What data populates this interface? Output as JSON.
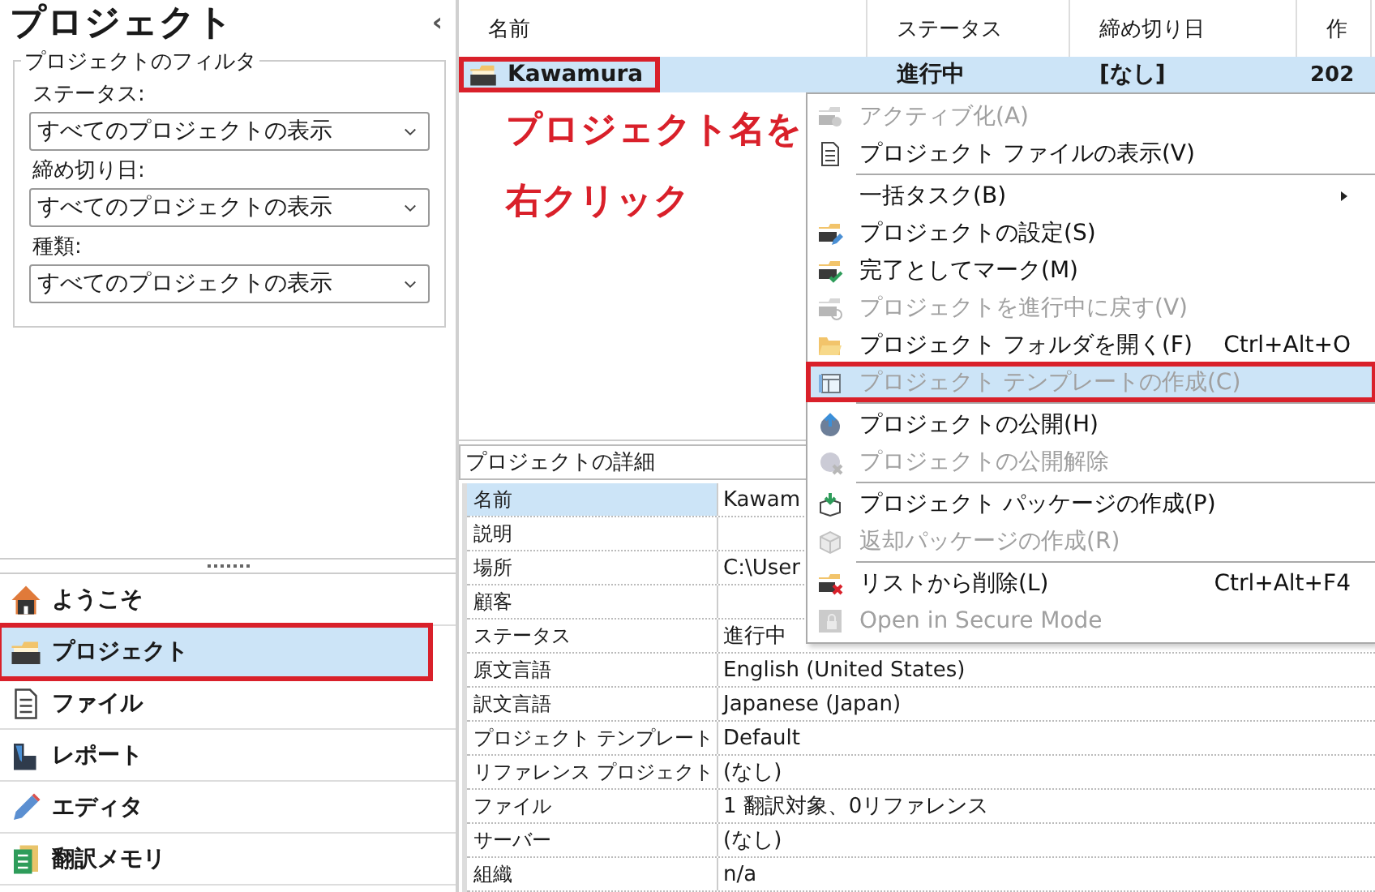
{
  "sidebar": {
    "title": "プロジェクト",
    "collapse_glyph": "‹",
    "filter": {
      "title": "プロジェクトのフィルタ",
      "fields": [
        {
          "label": "ステータス:",
          "value": "すべてのプロジェクトの表示"
        },
        {
          "label": "締め切り日:",
          "value": "すべてのプロジェクトの表示"
        },
        {
          "label": "種類:",
          "value": "すべてのプロジェクトの表示"
        }
      ]
    },
    "nav": [
      {
        "label": "ようこそ",
        "selected": false,
        "annotated": false
      },
      {
        "label": "プロジェクト",
        "selected": true,
        "annotated": true
      },
      {
        "label": "ファイル",
        "selected": false,
        "annotated": false
      },
      {
        "label": "レポート",
        "selected": false,
        "annotated": false
      },
      {
        "label": "エディタ",
        "selected": false,
        "annotated": false
      },
      {
        "label": "翻訳メモリ",
        "selected": false,
        "annotated": false
      }
    ]
  },
  "projects": {
    "columns": [
      "名前",
      "ステータス",
      "締め切り日",
      "作"
    ],
    "rows": [
      {
        "cells": [
          "Kawamura",
          "進行中",
          "[なし]",
          "202"
        ],
        "selected": true,
        "annotated": true
      }
    ]
  },
  "callout": [
    "プロジェクト名を",
    "右クリック"
  ],
  "context_menu": [
    {
      "label": "アクティブ化(A)",
      "disabled": true,
      "hovered": false,
      "separator_before": false,
      "submenu": false,
      "annotated": false
    },
    {
      "label": "プロジェクト ファイルの表示(V)",
      "disabled": false,
      "hovered": false,
      "separator_before": false,
      "submenu": false,
      "annotated": false
    },
    {
      "label": "一括タスク(B)",
      "disabled": false,
      "hovered": false,
      "separator_before": true,
      "submenu": true,
      "annotated": false
    },
    {
      "label": "プロジェクトの設定(S)",
      "disabled": false,
      "hovered": false,
      "separator_before": false,
      "submenu": false,
      "annotated": false
    },
    {
      "label": "完了としてマーク(M)",
      "disabled": false,
      "hovered": false,
      "separator_before": false,
      "submenu": false,
      "annotated": false
    },
    {
      "label": "プロジェクトを進行中に戻す(V)",
      "disabled": true,
      "hovered": false,
      "separator_before": false,
      "submenu": false,
      "annotated": false
    },
    {
      "label": "プロジェクト フォルダを開く(F)",
      "shortcut": "Ctrl+Alt+O",
      "disabled": false,
      "hovered": false,
      "separator_before": false,
      "submenu": false,
      "annotated": false
    },
    {
      "label": "プロジェクト テンプレートの作成(C)",
      "disabled": true,
      "hovered": true,
      "separator_before": false,
      "submenu": false,
      "annotated": true
    },
    {
      "label": "プロジェクトの公開(H)",
      "disabled": false,
      "hovered": false,
      "separator_before": true,
      "submenu": false,
      "annotated": false
    },
    {
      "label": "プロジェクトの公開解除",
      "disabled": true,
      "hovered": false,
      "separator_before": false,
      "submenu": false,
      "annotated": false
    },
    {
      "label": "プロジェクト パッケージの作成(P)",
      "disabled": false,
      "hovered": false,
      "separator_before": true,
      "submenu": false,
      "annotated": false
    },
    {
      "label": "返却パッケージの作成(R)",
      "disabled": true,
      "hovered": false,
      "separator_before": false,
      "submenu": false,
      "annotated": false
    },
    {
      "label": "リストから削除(L)",
      "shortcut": "Ctrl+Alt+F4",
      "disabled": false,
      "hovered": false,
      "separator_before": true,
      "submenu": false,
      "annotated": false
    },
    {
      "label": "Open in Secure Mode",
      "disabled": true,
      "hovered": false,
      "separator_before": false,
      "submenu": false,
      "annotated": false
    }
  ],
  "details": {
    "title": "プロジェクトの詳細",
    "rows": [
      {
        "label": "名前",
        "value": "Kawam",
        "selected": true
      },
      {
        "label": "説明",
        "value": "",
        "selected": false
      },
      {
        "label": "場所",
        "value": "C:\\User",
        "selected": false
      },
      {
        "label": "顧客",
        "value": "",
        "selected": false
      },
      {
        "label": "ステータス",
        "value": "進行中",
        "selected": false
      },
      {
        "label": "原文言語",
        "value": "English (United States)",
        "selected": false
      },
      {
        "label": "訳文言語",
        "value": "Japanese (Japan)",
        "selected": false
      },
      {
        "label": "プロジェクト テンプレート",
        "value": "Default",
        "selected": false
      },
      {
        "label": "リファレンス プロジェクト",
        "value": "(なし)",
        "selected": false
      },
      {
        "label": "ファイル",
        "value": "1 翻訳対象、0リファレンス",
        "selected": false
      },
      {
        "label": "サーバー",
        "value": "(なし)",
        "selected": false
      },
      {
        "label": "組織",
        "value": "n/a",
        "selected": false
      }
    ]
  }
}
